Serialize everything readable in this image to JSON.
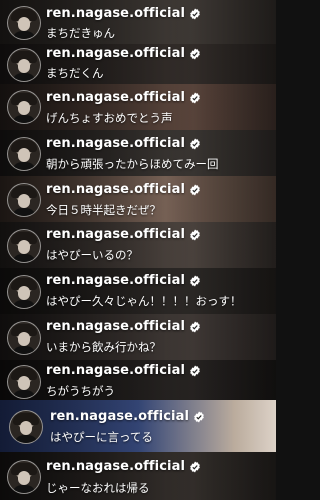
{
  "username": "ren.nagase.official",
  "icons": {
    "verified": "verified-badge-icon",
    "avatar": "profile-avatar"
  },
  "comments": [
    {
      "text": "まちだきゅん",
      "bg": "#3b3734"
    },
    {
      "text": "まちだくん",
      "bg": "#2a2523"
    },
    {
      "text": "げんちょすおめでとう声",
      "bg": "#4a3a33"
    },
    {
      "text": "朝から頑張ったからほめてみー回",
      "bg": "#2e2a28"
    },
    {
      "text": "今日５時半起きだぜ？",
      "bg": "#5a4a40"
    },
    {
      "text": "はやぴーいるの？",
      "bg": "#3a3430"
    },
    {
      "text": "はやぴー久々じゃん！！！！おっす！",
      "bg": "#241f1d"
    },
    {
      "text": "いまから飲み行かね？",
      "bg": "#2f2a27"
    },
    {
      "text": "ちがうちがう",
      "bg": "#1f1c1b"
    },
    {
      "text": "はやぴーに言ってる",
      "bg": "#2b3b6a"
    },
    {
      "text": "じゃーなおれは帰る",
      "bg": "#2a2624"
    }
  ],
  "colors": {
    "text": "#ffffff",
    "verified_fill": "#ffffff"
  }
}
